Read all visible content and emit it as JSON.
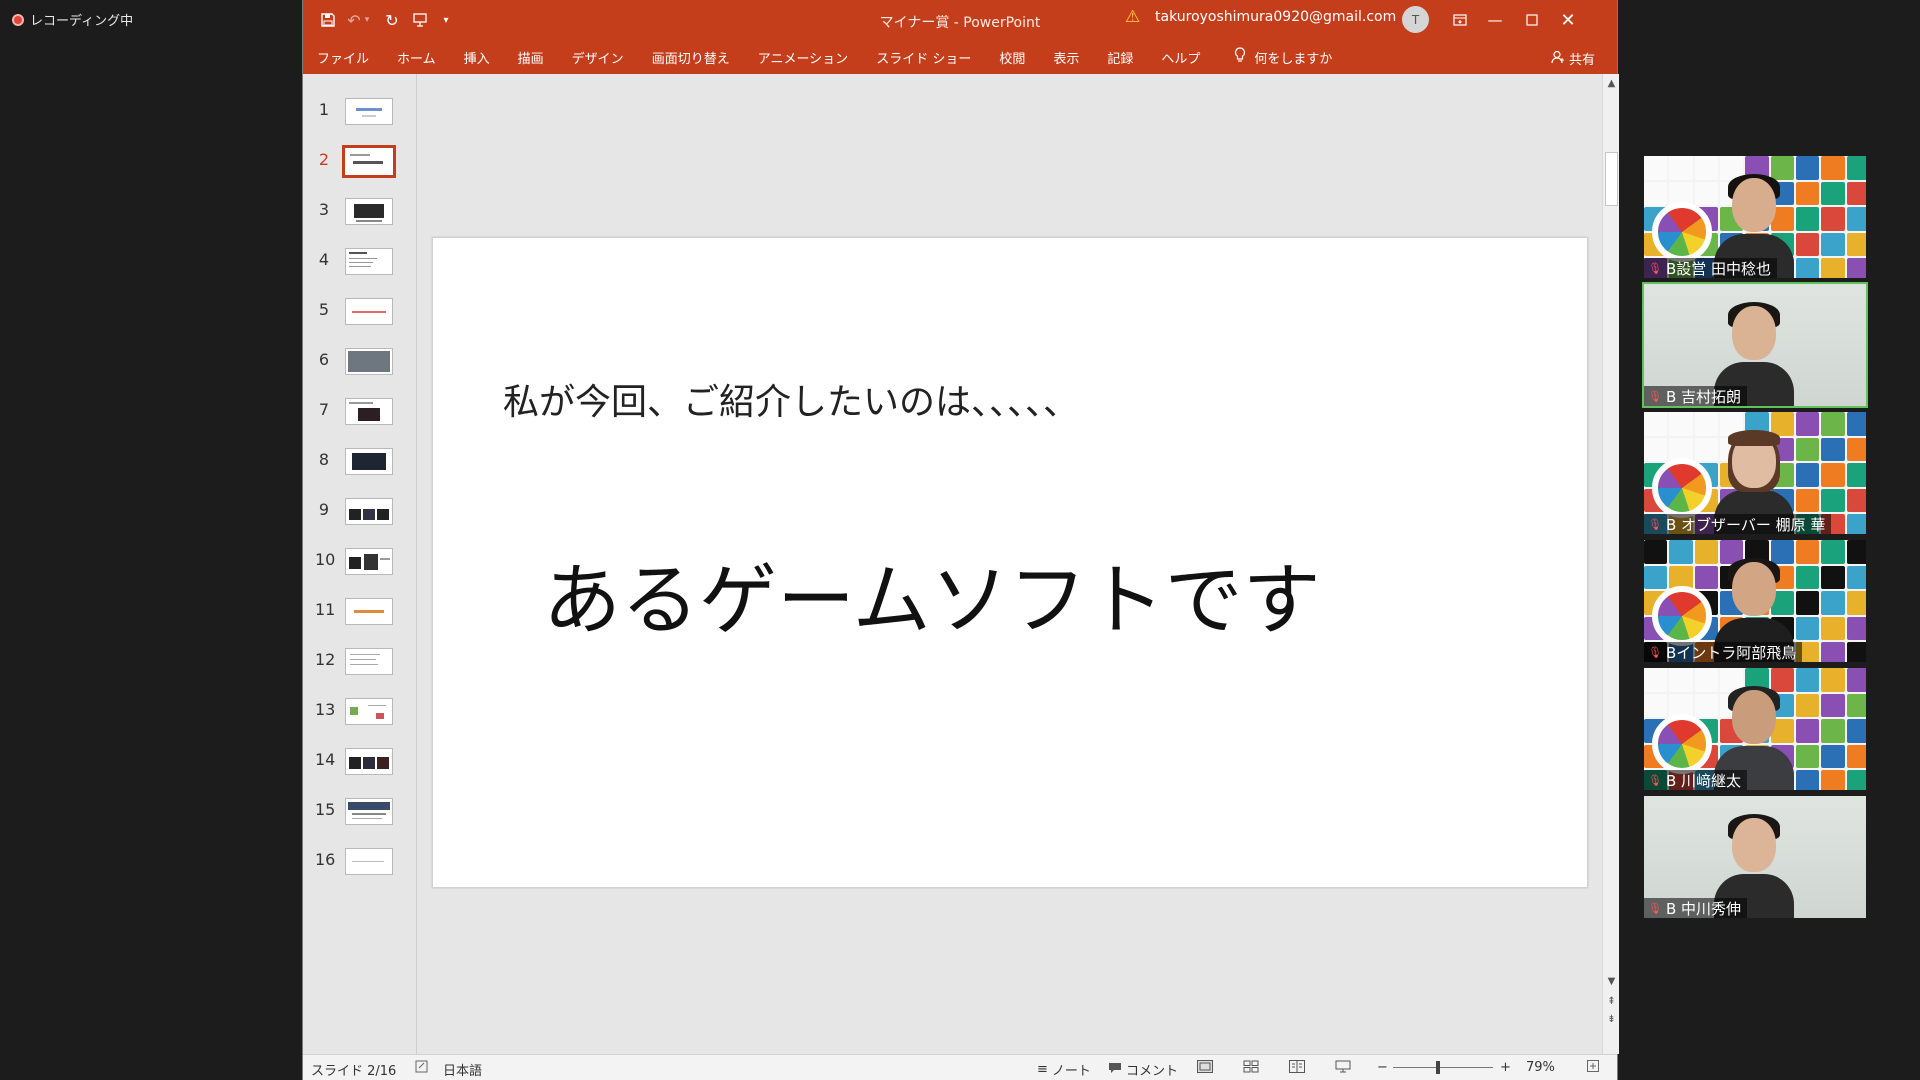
{
  "recording": {
    "label": "レコーディング中"
  },
  "window": {
    "doc_title": "マイナー賞 - PowerPoint",
    "account": "takuroyoshimura0920@gmail.com",
    "avatar_initial": "T",
    "share_label": "共有",
    "tell_me": "何をしますか"
  },
  "menu": [
    "ファイル",
    "ホーム",
    "挿入",
    "描画",
    "デザイン",
    "画面切り替え",
    "アニメーション",
    "スライド ショー",
    "校閲",
    "表示",
    "記録",
    "ヘルプ"
  ],
  "slides": [
    {
      "n": "1"
    },
    {
      "n": "2"
    },
    {
      "n": "3"
    },
    {
      "n": "4"
    },
    {
      "n": "5"
    },
    {
      "n": "6"
    },
    {
      "n": "7"
    },
    {
      "n": "8"
    },
    {
      "n": "9"
    },
    {
      "n": "10"
    },
    {
      "n": "11"
    },
    {
      "n": "12"
    },
    {
      "n": "13"
    },
    {
      "n": "14"
    },
    {
      "n": "15"
    },
    {
      "n": "16"
    }
  ],
  "active_slide": 2,
  "slide": {
    "subtitle": "私が今回、ご紹介したいのは、、、、、",
    "headline": "あるゲームソフトです"
  },
  "status": {
    "slide_counter": "スライド 2/16",
    "language": "日本語",
    "notes": "ノート",
    "comments": "コメント",
    "zoom_minus": "−",
    "zoom_plus": "+",
    "zoom": "79%"
  },
  "participants": [
    {
      "name": "B設営 田中稔也",
      "bg": "poster"
    },
    {
      "name": "B 吉村拓朗",
      "bg": "room"
    },
    {
      "name": "B オブザーバー 棚原 華",
      "bg": "poster"
    },
    {
      "name": "Bイントラ阿部飛鳥",
      "bg": "justdoit"
    },
    {
      "name": "B 川﨑継太",
      "bg": "poster"
    },
    {
      "name": "B 中川秀伸",
      "bg": "room"
    }
  ],
  "colors": {
    "ppt_accent": "#c43e1c",
    "active_speaker": "#62c15b"
  }
}
